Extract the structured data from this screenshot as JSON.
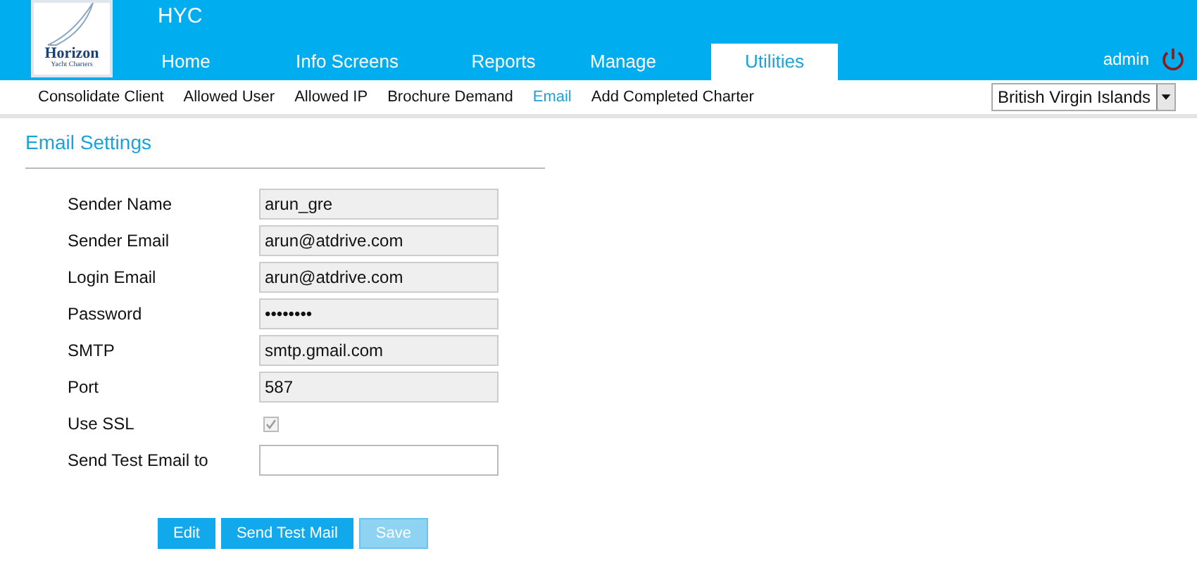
{
  "logo": {
    "name": "Horizon",
    "tagline": "Yacht Charters"
  },
  "app_title": "HYC",
  "tabs": [
    {
      "label": "Home",
      "selected": false
    },
    {
      "label": "Info Screens",
      "selected": false
    },
    {
      "label": "Reports",
      "selected": false
    },
    {
      "label": "Manage",
      "selected": false
    },
    {
      "label": "Utilities",
      "selected": true
    }
  ],
  "user": "admin",
  "subnav": [
    {
      "label": "Consolidate Client",
      "selected": false
    },
    {
      "label": "Allowed User",
      "selected": false
    },
    {
      "label": "Allowed IP",
      "selected": false
    },
    {
      "label": "Brochure Demand",
      "selected": false
    },
    {
      "label": "Email",
      "selected": true
    },
    {
      "label": "Add Completed Charter",
      "selected": false
    }
  ],
  "region_select": {
    "value": "British Virgin Islands"
  },
  "section_title": "Email Settings",
  "fields": [
    {
      "kind": "text",
      "label": "Sender Name",
      "value": "arun_gre",
      "disabled": true
    },
    {
      "kind": "text",
      "label": "Sender Email",
      "value": "arun@atdrive.com",
      "disabled": true
    },
    {
      "kind": "text",
      "label": "Login Email",
      "value": "arun@atdrive.com",
      "disabled": true
    },
    {
      "kind": "text",
      "label": "Password",
      "value": "••••••••",
      "disabled": true
    },
    {
      "kind": "text",
      "label": "SMTP",
      "value": "smtp.gmail.com",
      "disabled": true
    },
    {
      "kind": "text",
      "label": "Port",
      "value": "587",
      "disabled": true
    },
    {
      "kind": "checkbox",
      "label": "Use SSL",
      "checked": true,
      "disabled": true
    },
    {
      "kind": "text",
      "label": "Send Test Email to",
      "disabled": false
    }
  ],
  "buttons": [
    {
      "label": "Edit",
      "disabled": false
    },
    {
      "label": "Send Test Mail",
      "disabled": false
    },
    {
      "label": "Save",
      "disabled": true
    }
  ]
}
